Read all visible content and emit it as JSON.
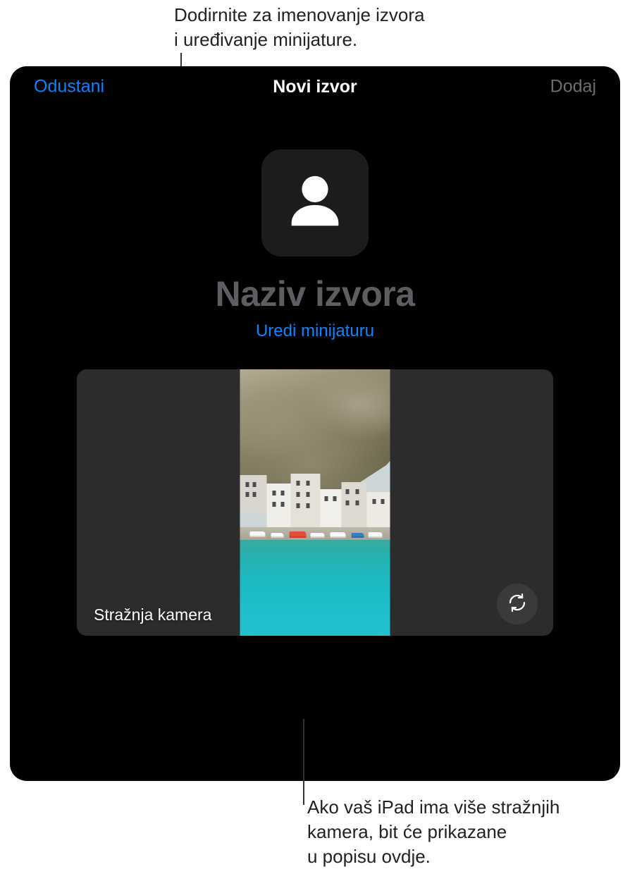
{
  "callouts": {
    "top": "Dodirnite za imenovanje izvora\ni uređivanje minijature.",
    "bottom": "Ako vaš iPad ima više stražnjih\nkamera, bit će prikazane\nu popisu ovdje."
  },
  "header": {
    "cancel_label": "Odustani",
    "title": "Novi izvor",
    "add_label": "Dodaj"
  },
  "source": {
    "name_placeholder": "Naziv izvora",
    "edit_thumbnail_label": "Uredi minijaturu"
  },
  "preview": {
    "camera_label": "Stražnja kamera"
  },
  "colors": {
    "accent": "#0b84ff",
    "bg_panel": "#000000",
    "muted": "#6d6d70",
    "placeholder": "#5e5e62",
    "tile": "#2c2c2e"
  },
  "icons": {
    "person_placeholder": "person-icon",
    "camera_flip": "camera-flip-icon"
  }
}
